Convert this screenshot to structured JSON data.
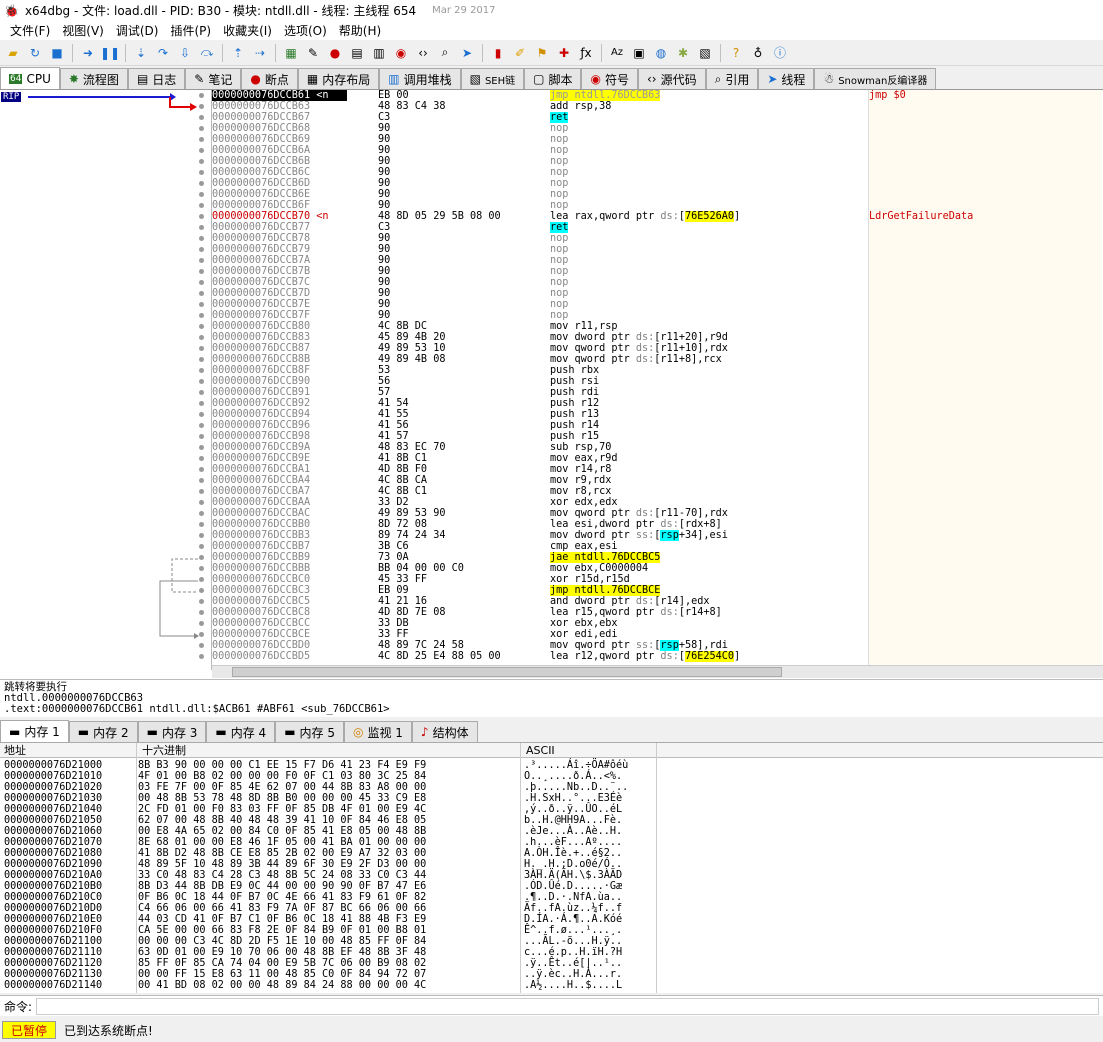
{
  "window": {
    "title": "x64dbg - 文件: load.dll - PID: B30 - 模块: ntdll.dll - 线程: 主线程 654",
    "date": "Mar 29 2017"
  },
  "menu": [
    "文件(F)",
    "视图(V)",
    "调试(D)",
    "插件(P)",
    "收藏夹(I)",
    "选项(O)",
    "帮助(H)"
  ],
  "tabs": [
    "CPU",
    "流程图",
    "日志",
    "笔记",
    "断点",
    "内存布局",
    "调用堆栈",
    "SEH链",
    "脚本",
    "符号",
    "源代码",
    "引用",
    "线程",
    "Snowman反编译器"
  ],
  "rip_label": "RIP",
  "disasm": [
    {
      "addr": "0000000076DCCB61 <n",
      "bytes": "EB 00",
      "ins": "jmp ntdll.76DCCB63",
      "cmt": "jmp $0"
    },
    {
      "addr": "0000000076DCCB63",
      "bytes": "48 83 C4 38",
      "ins": "add rsp,38",
      "cmt": ""
    },
    {
      "addr": "0000000076DCCB67",
      "bytes": "C3",
      "ins": "ret",
      "cmt": ""
    },
    {
      "addr": "0000000076DCCB68",
      "bytes": "90",
      "ins": "nop",
      "cmt": ""
    },
    {
      "addr": "0000000076DCCB69",
      "bytes": "90",
      "ins": "nop",
      "cmt": ""
    },
    {
      "addr": "0000000076DCCB6A",
      "bytes": "90",
      "ins": "nop",
      "cmt": ""
    },
    {
      "addr": "0000000076DCCB6B",
      "bytes": "90",
      "ins": "nop",
      "cmt": ""
    },
    {
      "addr": "0000000076DCCB6C",
      "bytes": "90",
      "ins": "nop",
      "cmt": ""
    },
    {
      "addr": "0000000076DCCB6D",
      "bytes": "90",
      "ins": "nop",
      "cmt": ""
    },
    {
      "addr": "0000000076DCCB6E",
      "bytes": "90",
      "ins": "nop",
      "cmt": ""
    },
    {
      "addr": "0000000076DCCB6F",
      "bytes": "90",
      "ins": "nop",
      "cmt": ""
    },
    {
      "addr": "0000000076DCCB70 <n",
      "bytes": "48 8D 05 29 5B 08 00",
      "ins": "lea rax,qword ptr ds:[76E526A0]",
      "cmt": "LdrGetFailureData"
    },
    {
      "addr": "0000000076DCCB77",
      "bytes": "C3",
      "ins": "ret",
      "cmt": ""
    },
    {
      "addr": "0000000076DCCB78",
      "bytes": "90",
      "ins": "nop",
      "cmt": ""
    },
    {
      "addr": "0000000076DCCB79",
      "bytes": "90",
      "ins": "nop",
      "cmt": ""
    },
    {
      "addr": "0000000076DCCB7A",
      "bytes": "90",
      "ins": "nop",
      "cmt": ""
    },
    {
      "addr": "0000000076DCCB7B",
      "bytes": "90",
      "ins": "nop",
      "cmt": ""
    },
    {
      "addr": "0000000076DCCB7C",
      "bytes": "90",
      "ins": "nop",
      "cmt": ""
    },
    {
      "addr": "0000000076DCCB7D",
      "bytes": "90",
      "ins": "nop",
      "cmt": ""
    },
    {
      "addr": "0000000076DCCB7E",
      "bytes": "90",
      "ins": "nop",
      "cmt": ""
    },
    {
      "addr": "0000000076DCCB7F",
      "bytes": "90",
      "ins": "nop",
      "cmt": ""
    },
    {
      "addr": "0000000076DCCB80",
      "bytes": "4C 8B DC",
      "ins": "mov r11,rsp",
      "cmt": ""
    },
    {
      "addr": "0000000076DCCB83",
      "bytes": "45 89 4B 20",
      "ins": "mov dword ptr ds:[r11+20],r9d",
      "cmt": ""
    },
    {
      "addr": "0000000076DCCB87",
      "bytes": "49 89 53 10",
      "ins": "mov qword ptr ds:[r11+10],rdx",
      "cmt": ""
    },
    {
      "addr": "0000000076DCCB8B",
      "bytes": "49 89 4B 08",
      "ins": "mov qword ptr ds:[r11+8],rcx",
      "cmt": ""
    },
    {
      "addr": "0000000076DCCB8F",
      "bytes": "53",
      "ins": "push rbx",
      "cmt": ""
    },
    {
      "addr": "0000000076DCCB90",
      "bytes": "56",
      "ins": "push rsi",
      "cmt": ""
    },
    {
      "addr": "0000000076DCCB91",
      "bytes": "57",
      "ins": "push rdi",
      "cmt": ""
    },
    {
      "addr": "0000000076DCCB92",
      "bytes": "41 54",
      "ins": "push r12",
      "cmt": ""
    },
    {
      "addr": "0000000076DCCB94",
      "bytes": "41 55",
      "ins": "push r13",
      "cmt": ""
    },
    {
      "addr": "0000000076DCCB96",
      "bytes": "41 56",
      "ins": "push r14",
      "cmt": ""
    },
    {
      "addr": "0000000076DCCB98",
      "bytes": "41 57",
      "ins": "push r15",
      "cmt": ""
    },
    {
      "addr": "0000000076DCCB9A",
      "bytes": "48 83 EC 70",
      "ins": "sub rsp,70",
      "cmt": ""
    },
    {
      "addr": "0000000076DCCB9E",
      "bytes": "41 8B C1",
      "ins": "mov eax,r9d",
      "cmt": ""
    },
    {
      "addr": "0000000076DCCBA1",
      "bytes": "4D 8B F0",
      "ins": "mov r14,r8",
      "cmt": ""
    },
    {
      "addr": "0000000076DCCBA4",
      "bytes": "4C 8B CA",
      "ins": "mov r9,rdx",
      "cmt": ""
    },
    {
      "addr": "0000000076DCCBA7",
      "bytes": "4C 8B C1",
      "ins": "mov r8,rcx",
      "cmt": ""
    },
    {
      "addr": "0000000076DCCBAA",
      "bytes": "33 D2",
      "ins": "xor edx,edx",
      "cmt": ""
    },
    {
      "addr": "0000000076DCCBAC",
      "bytes": "49 89 53 90",
      "ins": "mov qword ptr ds:[r11-70],rdx",
      "cmt": ""
    },
    {
      "addr": "0000000076DCCBB0",
      "bytes": "8D 72 08",
      "ins": "lea esi,dword ptr ds:[rdx+8]",
      "cmt": ""
    },
    {
      "addr": "0000000076DCCBB3",
      "bytes": "89 74 24 34",
      "ins": "mov dword ptr ss:[rsp+34],esi",
      "cmt": ""
    },
    {
      "addr": "0000000076DCCBB7",
      "bytes": "3B C6",
      "ins": "cmp eax,esi",
      "cmt": ""
    },
    {
      "addr": "0000000076DCCBB9",
      "bytes": "73 0A",
      "ins": "jae ntdll.76DCCBC5",
      "cmt": ""
    },
    {
      "addr": "0000000076DCCBBB",
      "bytes": "BB 04 00 00 C0",
      "ins": "mov ebx,C0000004",
      "cmt": ""
    },
    {
      "addr": "0000000076DCCBC0",
      "bytes": "45 33 FF",
      "ins": "xor r15d,r15d",
      "cmt": ""
    },
    {
      "addr": "0000000076DCCBC3",
      "bytes": "EB 09",
      "ins": "jmp ntdll.76DCCBCE",
      "cmt": ""
    },
    {
      "addr": "0000000076DCCBC5",
      "bytes": "41 21 16",
      "ins": "and dword ptr ds:[r14],edx",
      "cmt": ""
    },
    {
      "addr": "0000000076DCCBC8",
      "bytes": "4D 8D 7E 08",
      "ins": "lea r15,qword ptr ds:[r14+8]",
      "cmt": ""
    },
    {
      "addr": "0000000076DCCBCC",
      "bytes": "33 DB",
      "ins": "xor ebx,ebx",
      "cmt": ""
    },
    {
      "addr": "0000000076DCCBCE",
      "bytes": "33 FF",
      "ins": "xor edi,edi",
      "cmt": ""
    },
    {
      "addr": "0000000076DCCBD0",
      "bytes": "48 89 7C 24 58",
      "ins": "mov qword ptr ss:[rsp+58],rdi",
      "cmt": ""
    },
    {
      "addr": "0000000076DCCBD5",
      "bytes": "4C 8D 25 E4 88 05 00",
      "ins": "lea r12,qword ptr ds:[76E254C0]",
      "cmt": ""
    }
  ],
  "info_lines": [
    "跳转将要执行",
    "ntdll.0000000076DCCB63",
    ".text:0000000076DCCB61 ntdll.dll:$ACB61 #ABF61 <sub_76DCCB61>"
  ],
  "mem_tabs": [
    "内存 1",
    "内存 2",
    "内存 3",
    "内存 4",
    "内存 5",
    "监视 1",
    "结构体"
  ],
  "dump_headers": {
    "addr": "地址",
    "hex": "十六进制",
    "ascii": "ASCII"
  },
  "dump": [
    {
      "addr": "0000000076D21000",
      "hex": "8B B3 90 00 00 00 C1 EE 15 F7 D6 41 23 F4 E9 F9",
      "ascii": ".³.....Áî.÷ÖA#ôéù"
    },
    {
      "addr": "0000000076D21010",
      "hex": "4F 01 00 B8 02 00 00 00 F0 0F C1 03 80 3C 25 84",
      "ascii": "O..¸....ð.Á..<%."
    },
    {
      "addr": "0000000076D21020",
      "hex": "03 FE 7F 00 0F 85 4E 62 07 00 44 8B 83 A8 00 00",
      "ascii": ".þ.....Nb..D..¨.."
    },
    {
      "addr": "0000000076D21030",
      "hex": "00 48 8B 53 78 48 8D 8B B0 00 00 00 45 33 C9 E8",
      "ascii": ".H.SxH..°...E3Éè"
    },
    {
      "addr": "0000000076D21040",
      "hex": "2C FD 01 00 F0 83 03 FF 0F 85 DB 4F 01 00 E9 4C",
      "ascii": ",ý..ð..ÿ..ÛO..éL"
    },
    {
      "addr": "0000000076D21050",
      "hex": "62 07 00 48 8B 40 48 48 39 41 10 0F 84 46 E8 05",
      "ascii": "b..H.@HH9A...Fè."
    },
    {
      "addr": "0000000076D21060",
      "hex": "00 E8 4A 65 02 00 84 C0 0F 85 41 E8 05 00 48 8B",
      "ascii": ".èJe...À..Aè..H."
    },
    {
      "addr": "0000000076D21070",
      "hex": "8E 68 01 00 00 E8 46 1F 05 00 41 BA 01 00 00 00",
      "ascii": ".h...èF...Aº...."
    },
    {
      "addr": "0000000076D21080",
      "hex": "41 8B D2 48 8B CE E8 85 2B 02 00 E9 A7 32 03 00",
      "ascii": "A.ÒH.Îè.+..é§2.."
    },
    {
      "addr": "0000000076D21090",
      "hex": "48 89 5F 10 48 89 3B 44 89 6F 30 E9 2F D3 00 00",
      "ascii": "H._.H.;D.o0é/Ó.."
    },
    {
      "addr": "0000000076D210A0",
      "hex": "33 C0 48 83 C4 28 C3 48 8B 5C 24 08 33 C0 C3 44",
      "ascii": "3ÀH.Ä(ÃH.\\$.3ÀÃD"
    },
    {
      "addr": "0000000076D210B0",
      "hex": "8B D3 44 8B DB E9 0C 44 00 00 90 90 0F B7 47 E6",
      "ascii": ".ÓD.Ûé.D.....·Gæ"
    },
    {
      "addr": "0000000076D210C0",
      "hex": "0F B6 0C 18 44 0F B7 0C 4E 66 41 83 F9 61 0F 82",
      "ascii": ".¶..D.·.NfA.ùa.."
    },
    {
      "addr": "0000000076D210D0",
      "hex": "C4 66 06 00 66 41 83 F9 7A 0F 87 BC 66 06 00 66",
      "ascii": "Äf..fA.ùz..¼f..f"
    },
    {
      "addr": "0000000076D210E0",
      "hex": "44 03 CD 41 0F B7 C1 0F B6 0C 18 41 88 4B F3 E9",
      "ascii": "D.ÍA.·Á.¶..A.Kóé"
    },
    {
      "addr": "0000000076D210F0",
      "hex": "CA 5E 00 00 66 83 F8 2E 0F 84 B9 0F 01 00 B8 01",
      "ascii": "Ê^..f.ø...¹...¸."
    },
    {
      "addr": "0000000076D21100",
      "hex": "00 00 00 C3 4C 8D 2D F5 1E 10 00 48 85 FF 0F 84",
      "ascii": "...ÃL.-õ...H.ÿ.."
    },
    {
      "addr": "0000000076D21110",
      "hex": "63 0D 01 00 E9 10 70 06 00 48 8B EF 48 8B 3F 48",
      "ascii": "c...é.p..H.ïH.?H"
    },
    {
      "addr": "0000000076D21120",
      "hex": "85 FF 0F 85 CA 74 04 00 E9 5B 7C 06 00 B9 08 02",
      "ascii": ".ÿ..Êt..é[|..¹.."
    },
    {
      "addr": "0000000076D21130",
      "hex": "00 00 FF 15 E8 63 11 00 48 85 C0 0F 84 94 72 07",
      "ascii": "..ÿ.èc..H.À...r."
    },
    {
      "addr": "0000000076D21140",
      "hex": "00 41 BD 08 02 00 00 48 89 84 24 88 00 00 00 4C",
      "ascii": ".A½....H..$....L"
    }
  ],
  "command_label": "命令:",
  "status": {
    "state": "已暂停",
    "message": "已到达系统断点!"
  },
  "colors": {
    "highlight_yellow": "#ffff00",
    "highlight_cyan": "#00ffff",
    "rip_bg": "#000080",
    "comment_red": "#cc0000"
  }
}
